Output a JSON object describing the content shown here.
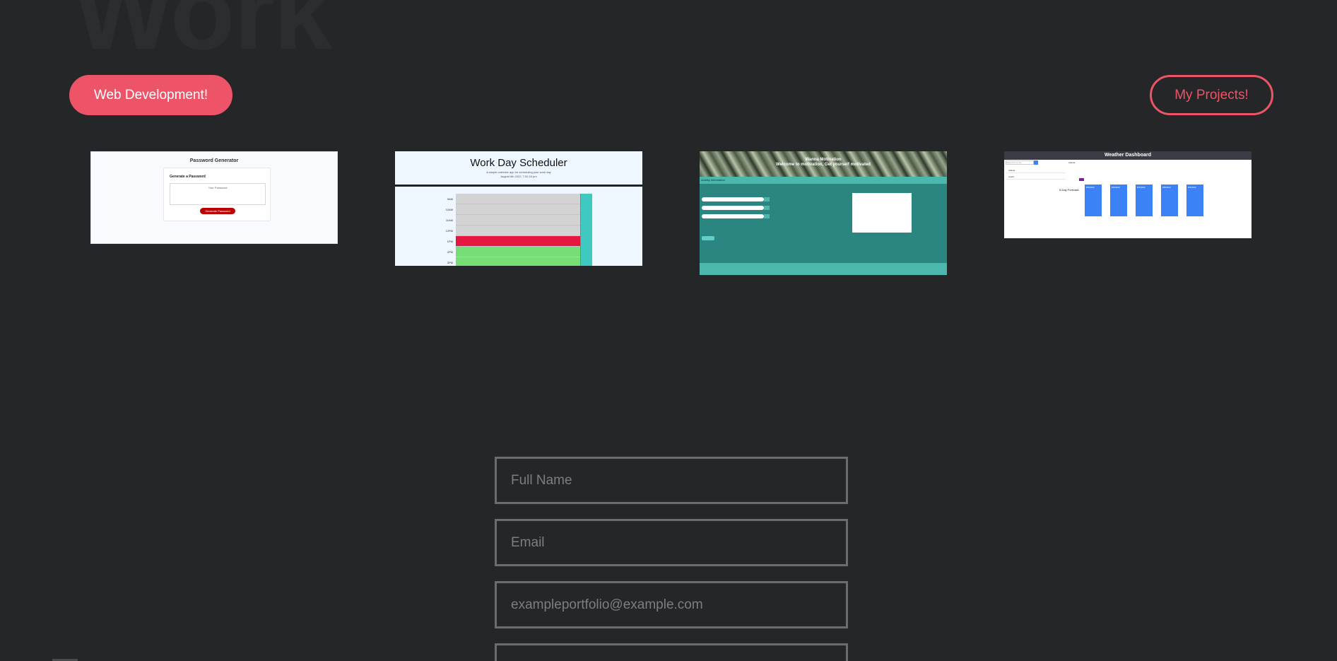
{
  "section": {
    "title": "Work"
  },
  "buttons": {
    "web_dev": "Web Development!",
    "projects": "My Projects!"
  },
  "thumbs": {
    "password": {
      "title": "Password Generator",
      "card_title": "Generate a Password",
      "textarea": "Your Password",
      "button": "Generate Password"
    },
    "scheduler": {
      "title": "Work Day Scheduler",
      "subtitle_line1": "A simple calendar app for scheduling your work day",
      "subtitle_line2": "August 4th 2022, 7:52:24 pm",
      "rows": [
        {
          "time": "9AM",
          "status": "past"
        },
        {
          "time": "10AM",
          "status": "past"
        },
        {
          "time": "11AM",
          "status": "past"
        },
        {
          "time": "12PM",
          "status": "past"
        },
        {
          "time": "1PM",
          "status": "present"
        },
        {
          "time": "2PM",
          "status": "future"
        },
        {
          "time": "3PM",
          "status": "future"
        }
      ],
      "colors": {
        "past": "#d3d3d3",
        "present": "#e5163f",
        "future": "#77dd77"
      }
    },
    "motivation": {
      "banner_line1": "Wanna Motivation",
      "banner_line2": "Welcome to motivation, Get yourself motivated",
      "label": "Activity Information"
    },
    "weather": {
      "title": "Weather Dashboard",
      "search_placeholder": "Search for a city",
      "cities": [
        "Atlanta",
        "Austin"
      ],
      "current_city": "Atlanta",
      "forecast_title": "5-Day Forecast:",
      "cards": [
        "8/5/2022",
        "8/6/2022",
        "8/7/2022",
        "8/8/2022",
        "8/9/2022"
      ]
    }
  },
  "form": {
    "name_placeholder": "Full Name",
    "email_placeholder": "Email",
    "subject_placeholder": "exampleportfolio@example.com"
  },
  "colors": {
    "background": "#252628",
    "accent": "#ee5467",
    "field_border": "#6b6c6e"
  }
}
